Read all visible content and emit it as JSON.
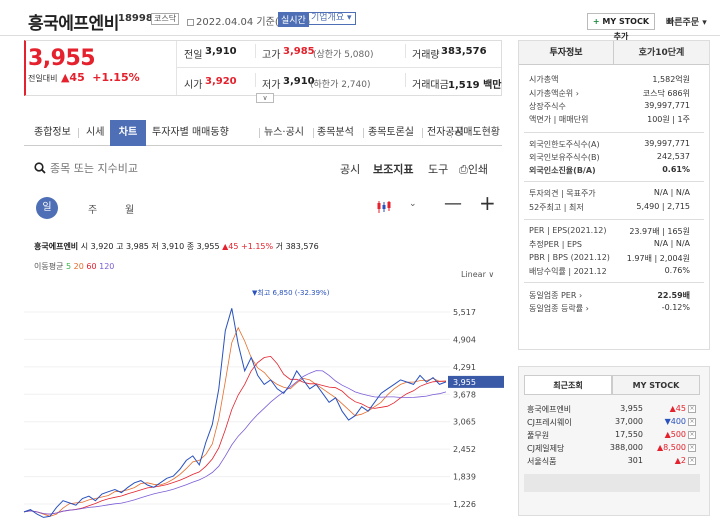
{
  "header": {
    "stock_name": "흥국에프엔비",
    "stock_code": "189980",
    "market_tag": "코스닥",
    "date_text": "2022.04.04 기준(장마감)",
    "realtime_tag": "실시간",
    "company_tag": "기업개요 ▾",
    "mystock_label": "MY STOCK 추가",
    "quick_order": "빠른주문 ▾"
  },
  "quote": {
    "price": "3,955",
    "change_label": "전일대비",
    "change_amount": "▲45",
    "change_pct": "+1.15%",
    "prev_close_label": "전일",
    "prev_close": "3,910",
    "high_label": "고가",
    "high": "3,985",
    "high_sub": "(상한가 5,080)",
    "volume_label": "거래량",
    "volume": "383,576",
    "open_label": "시가",
    "open": "3,920",
    "low_label": "저가",
    "low": "3,910",
    "low_sub": "(하한가 2,740)",
    "amount_label": "거래대금",
    "amount": "1,519 백만"
  },
  "nav": {
    "items": [
      "종합정보",
      "시세",
      "차트",
      "투자자별 매매동향",
      "뉴스·공시",
      "종목분석",
      "종목토론실",
      "전자공시",
      "공매도현황"
    ],
    "active": "차트"
  },
  "toolbar": {
    "search_placeholder": "종목 또는 지수비교",
    "disclosure": "공시",
    "indicator": "보조지표",
    "tools": "도구",
    "print": "인쇄",
    "periods": [
      "일",
      "주",
      "월"
    ],
    "scale_label": "Linear ∨"
  },
  "chart_info": {
    "name": "흥국에프엔비",
    "text": "시 3,920  고 3,985  저 3,910  종 3,955",
    "change": "▲45 +1.15%",
    "volume": "거 383,576",
    "ma_label": "이동평균",
    "ma_periods": [
      "5",
      "20",
      "60",
      "120"
    ]
  },
  "side": {
    "tabs": [
      "투자정보",
      "호가10단계"
    ],
    "rows_a": [
      {
        "label": "시가총액",
        "value": "1,582억원"
      },
      {
        "label": "시가총액순위 ›",
        "value": "코스닥 686위"
      },
      {
        "label": "상장주식수",
        "value": "39,997,771"
      },
      {
        "label": "액면가 | 매매단위",
        "value": "100원 | 1주"
      }
    ],
    "rows_b": [
      {
        "label": "외국인한도주식수(A)",
        "value": "39,997,771"
      },
      {
        "label": "외국인보유주식수(B)",
        "value": "242,537"
      },
      {
        "label": "외국인소진율(B/A)",
        "value": "0.61%"
      }
    ],
    "rows_c": [
      {
        "label": "투자의견 | 목표주가",
        "value": "N/A | N/A"
      },
      {
        "label": "52주최고 | 최저",
        "value": "5,490 | 2,715"
      }
    ],
    "rows_d": [
      {
        "label": "PER | EPS(2021.12)",
        "value": "23.97배 | 165원"
      },
      {
        "label": "추정PER | EPS",
        "value": "N/A | N/A"
      },
      {
        "label": "PBR | BPS (2021.12)",
        "value": "1.97배 | 2,004원"
      },
      {
        "label": "배당수익률 | 2021.12",
        "value": "0.76%"
      }
    ],
    "rows_e": [
      {
        "label": "동일업종 PER ›",
        "value": "22.59배"
      },
      {
        "label": "동일업종 등락률 ›",
        "value": "-0.12%"
      }
    ]
  },
  "recent": {
    "tabs": [
      "최근조회",
      "MY STOCK"
    ],
    "items": [
      {
        "name": "흥국에프엔비",
        "price": "3,955",
        "change": "▲45",
        "dir": "up"
      },
      {
        "name": "CJ프레시웨이",
        "price": "37,000",
        "change": "▼400",
        "dir": "down"
      },
      {
        "name": "풀무원",
        "price": "17,550",
        "change": "▲500",
        "dir": "up"
      },
      {
        "name": "CJ제일제당",
        "price": "388,000",
        "change": "▲8,500",
        "dir": "up"
      },
      {
        "name": "서울식품",
        "price": "301",
        "change": "▲2",
        "dir": "up"
      }
    ]
  },
  "chart_data": {
    "type": "line",
    "y_ticks": [
      5517,
      4904,
      4291,
      3678,
      3065,
      2452,
      1839,
      1226
    ],
    "current_price": 3955,
    "peak_label": "▼최고 6,850 (-32.39%)",
    "series": [
      {
        "values": [
          1050,
          1100,
          1000,
          900,
          950,
          1150,
          1300,
          1250,
          1200,
          1350,
          1400,
          1300,
          1450,
          1500,
          1550,
          1480,
          1600,
          1700,
          1750,
          1650,
          1600,
          1700,
          1800,
          1850,
          2000,
          2200,
          2300,
          2100,
          2600,
          3000,
          3800,
          5100,
          5600,
          4800,
          4200,
          4500,
          4100,
          3900,
          4000,
          3800,
          3700,
          3900,
          4200,
          4000,
          3800,
          3900,
          3700,
          3500,
          3600,
          3300,
          3100,
          3200,
          3400,
          3300,
          3500,
          3700,
          3800,
          3900,
          4000,
          3950,
          3900,
          4100,
          3950,
          4050,
          3900,
          3955
        ]
      }
    ]
  }
}
